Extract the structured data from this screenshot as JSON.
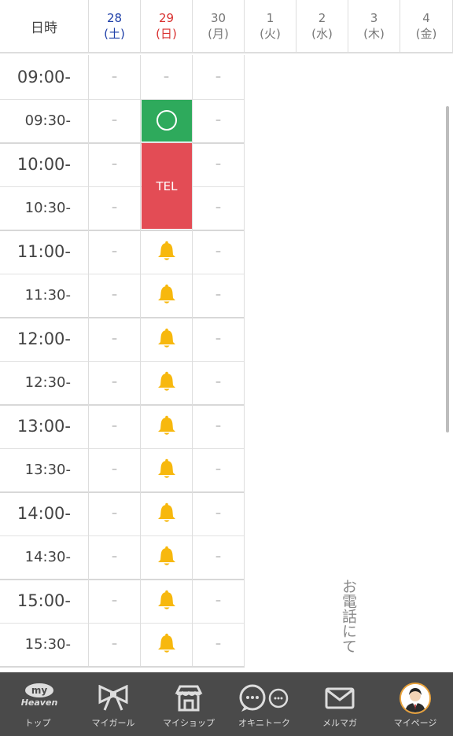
{
  "header": {
    "datetime_label": "日時",
    "days": [
      {
        "num": "28",
        "wk": "(土)",
        "kind": "sat"
      },
      {
        "num": "29",
        "wk": "(日)",
        "kind": "sun"
      },
      {
        "num": "30",
        "wk": "(月)",
        "kind": "normal"
      },
      {
        "num": "1",
        "wk": "(火)",
        "kind": "normal"
      },
      {
        "num": "2",
        "wk": "(水)",
        "kind": "normal"
      },
      {
        "num": "3",
        "wk": "(木)",
        "kind": "normal"
      },
      {
        "num": "4",
        "wk": "(金)",
        "kind": "normal"
      }
    ]
  },
  "slots": [
    {
      "time": "09:00-",
      "type": "full",
      "c28": "–",
      "c29": "–",
      "c30": "–"
    },
    {
      "time": "09:30-",
      "type": "half",
      "c28": "–",
      "c29": "available",
      "c30": "–"
    },
    {
      "time": "10:00-",
      "type": "full",
      "c28": "–",
      "c29": "tel",
      "c30": "–"
    },
    {
      "time": "10:30-",
      "type": "half",
      "c28": "–",
      "c29": "tel",
      "c30": "–"
    },
    {
      "time": "11:00-",
      "type": "full",
      "c28": "–",
      "c29": "bell",
      "c30": "–"
    },
    {
      "time": "11:30-",
      "type": "half",
      "c28": "–",
      "c29": "bell",
      "c30": "–"
    },
    {
      "time": "12:00-",
      "type": "full",
      "c28": "–",
      "c29": "bell",
      "c30": "–"
    },
    {
      "time": "12:30-",
      "type": "half",
      "c28": "–",
      "c29": "bell",
      "c30": "–"
    },
    {
      "time": "13:00-",
      "type": "full",
      "c28": "–",
      "c29": "bell",
      "c30": "–"
    },
    {
      "time": "13:30-",
      "type": "half",
      "c28": "–",
      "c29": "bell",
      "c30": "–"
    },
    {
      "time": "14:00-",
      "type": "full",
      "c28": "–",
      "c29": "bell",
      "c30": "–"
    },
    {
      "time": "14:30-",
      "type": "half",
      "c28": "–",
      "c29": "bell",
      "c30": "–"
    },
    {
      "time": "15:00-",
      "type": "full",
      "c28": "–",
      "c29": "bell",
      "c30": "–"
    },
    {
      "time": "15:30-",
      "type": "half",
      "c28": "–",
      "c29": "bell",
      "c30": "–"
    }
  ],
  "tel_label": "TEL",
  "vertical_note": "お電話にて",
  "icons": {
    "available": "circle-icon",
    "tel": "phone-label",
    "reserve": "bell-icon"
  },
  "colors": {
    "available": "#2eaa5c",
    "tel": "#e34c55",
    "bell": "#f7b80e",
    "saturday": "#1e3fa8",
    "sunday": "#d9302f",
    "tabbar": "#4a4a4a"
  },
  "tabbar": {
    "items": [
      {
        "label": "トップ",
        "icon": "myheaven-logo",
        "logo_top": "my",
        "logo_bottom": "Heaven"
      },
      {
        "label": "マイガール",
        "icon": "ribbon-icon"
      },
      {
        "label": "マイショップ",
        "icon": "shop-icon"
      },
      {
        "label": "オキニトーク",
        "icon": "chat-icon"
      },
      {
        "label": "メルマガ",
        "icon": "mail-icon"
      },
      {
        "label": "マイページ",
        "icon": "avatar-icon"
      }
    ]
  }
}
